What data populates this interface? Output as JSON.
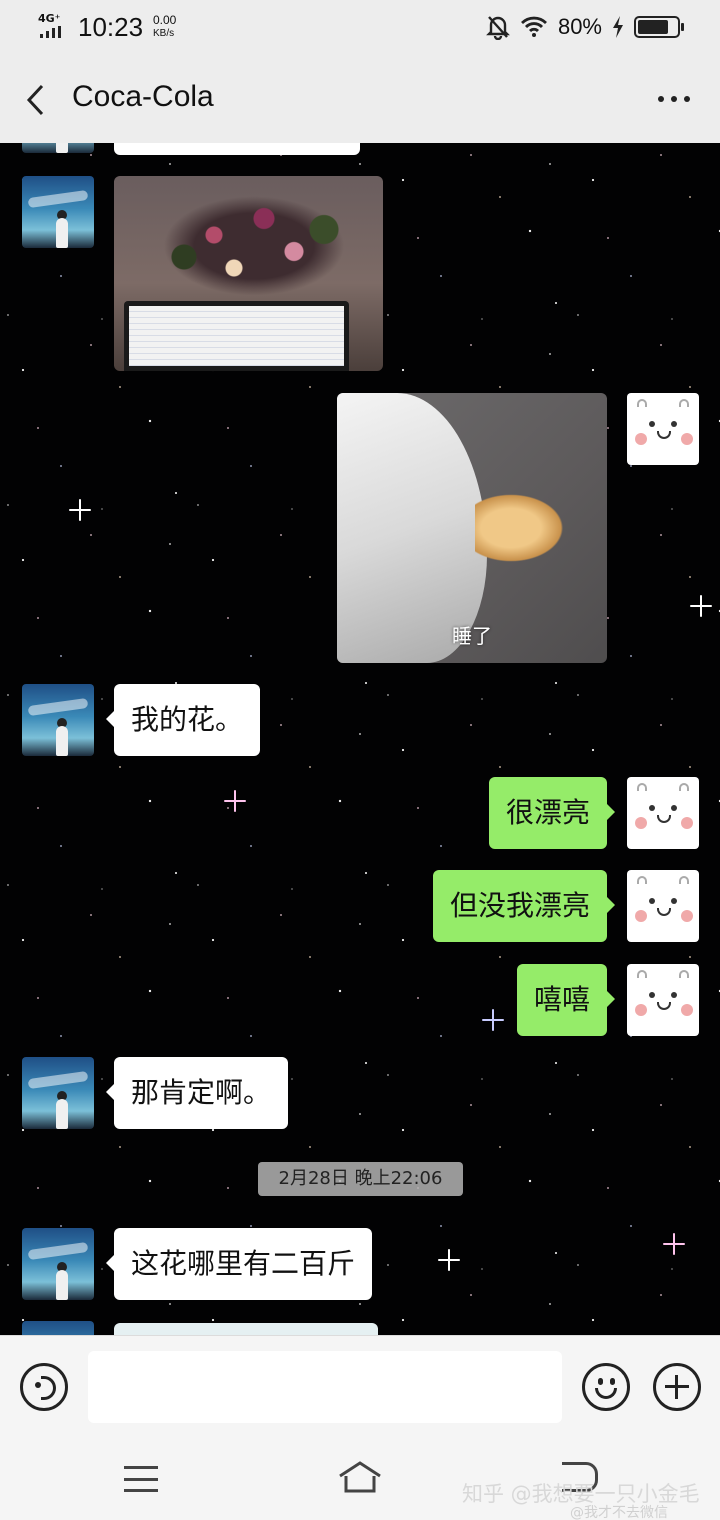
{
  "status_bar": {
    "network": "4G⁺",
    "time": "10:23",
    "speed_value": "0.00",
    "speed_unit": "KB/s",
    "battery_percent": "80%",
    "battery_level": 0.8,
    "icons": [
      "mute-bell-icon",
      "wifi-icon",
      "charging-icon",
      "battery-icon"
    ]
  },
  "header": {
    "title": "Coca-Cola",
    "back_icon": "chevron-left-icon",
    "more_icon": "more-dots-icon"
  },
  "messages": [
    {
      "side": "left",
      "type": "image",
      "content": "flowers-and-laptop-photo"
    },
    {
      "side": "right",
      "type": "image",
      "content": "sleeping-cat-photo",
      "caption": "睡了"
    },
    {
      "side": "left",
      "type": "text",
      "text": "我的花。"
    },
    {
      "side": "right",
      "type": "text",
      "text": "很漂亮"
    },
    {
      "side": "right",
      "type": "text",
      "text": "但没我漂亮"
    },
    {
      "side": "right",
      "type": "text",
      "text": "嘻嘻"
    },
    {
      "side": "left",
      "type": "text",
      "text": "那肯定啊。"
    },
    {
      "side": "left",
      "type": "text",
      "text": "这花哪里有二百斤"
    }
  ],
  "timestamp": "2月28日 晚上22:06",
  "input_bar": {
    "voice_icon": "voice-icon",
    "emoji_icon": "emoji-icon",
    "plus_icon": "plus-icon",
    "text_value": ""
  },
  "nav_bar": {
    "icons": [
      "menu-icon",
      "home-icon",
      "back-icon"
    ],
    "watermark": "知乎 @我想要一只小金毛",
    "watermark_weibo": "@我才不去微信"
  },
  "colors": {
    "header_bg": "#ededed",
    "bubble_self": "#95ec69",
    "bubble_other": "#ffffff",
    "chat_bg": "#020203"
  }
}
